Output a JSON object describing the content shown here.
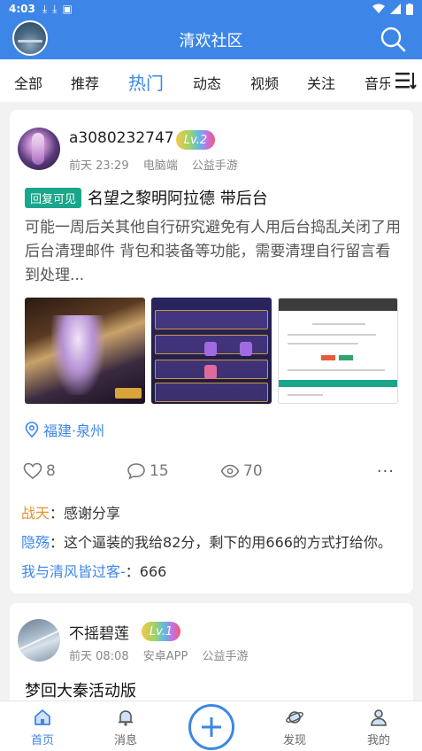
{
  "status_bar": {
    "time": "4:03"
  },
  "header": {
    "title": "清欢社区"
  },
  "tabs": [
    "全部",
    "推荐",
    "热门",
    "动态",
    "视频",
    "关注",
    "音乐"
  ],
  "active_tab": "热门",
  "posts": [
    {
      "username": "a3080232747",
      "level": "Lv.2",
      "time": "前天 23:29",
      "device": "电脑端",
      "category": "公益手游",
      "tag": "回复可见",
      "title": "名望之黎明阿拉德 带后台",
      "body": "可能一周后关其他自行研究避免有人用后台捣乱关闭了用后台清理邮件 背包和装备等功能，需要清理自行留言看到处理...",
      "location": "福建·泉州",
      "likes": "8",
      "comments_count": "15",
      "views": "70",
      "more": "···",
      "comments": [
        {
          "user": "战天",
          "sep": "：",
          "text": "感谢分享"
        },
        {
          "user": "隐殇",
          "sep": "：",
          "text": "这个逼装的我给82分，剩下的用666的方式打给你。"
        },
        {
          "user": "我与清风皆过客-",
          "sep": "：",
          "text": "666"
        }
      ]
    },
    {
      "username": "不摇碧莲",
      "level": "Lv.1",
      "time": "前天 08:08",
      "device": "安卓APP",
      "category": "公益手游",
      "title": "梦回大秦活动版"
    }
  ],
  "bottom_nav": {
    "home": "首页",
    "messages": "消息",
    "discover": "发现",
    "mine": "我的"
  },
  "colors": {
    "primary": "#3d86e8",
    "tag": "#1aa68a",
    "highlight_user": "#e8922f"
  }
}
